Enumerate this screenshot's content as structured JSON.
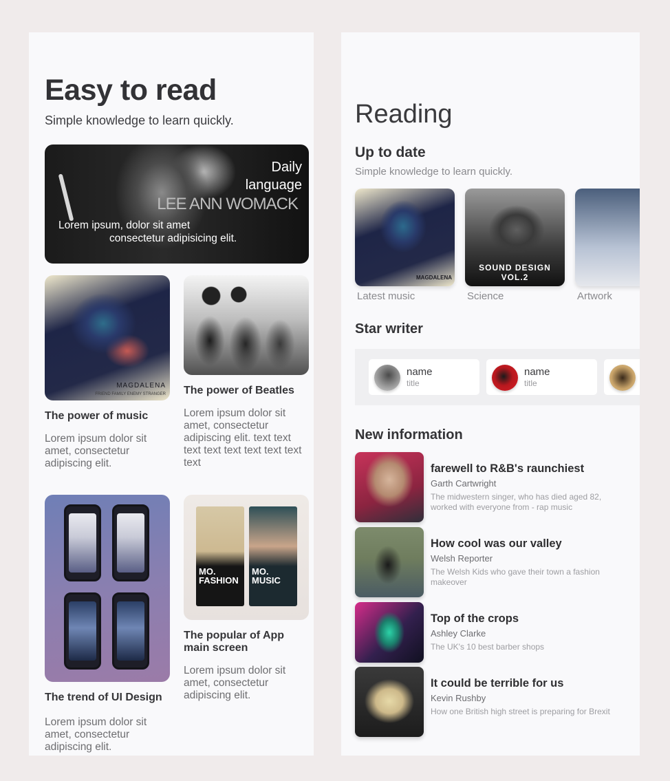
{
  "left": {
    "title": "Easy to read",
    "subtitle": "Simple knowledge to learn quickly.",
    "hero": {
      "title": "Daily language",
      "artist": "LEE ANN WOMACK",
      "text_line1": "Lorem ipsum, dolor sit amet",
      "text_line2": "consectetur adipisicing elit."
    },
    "cards": [
      {
        "title": "The power of music",
        "desc": "Lorem ipsum dolor sit amet, consectetur adipiscing elit.",
        "img_label": "MAGDALENA",
        "img_sub": "FRIEND   FAMILY   ENEMY   STRANGER"
      },
      {
        "title": "The power of Beatles",
        "desc": "Lorem ipsum dolor sit amet, consectetur adipiscing elit. text text text text text text text text text"
      },
      {
        "title": "The trend of UI Design",
        "desc": "Lorem ipsum dolor sit amet, consectetur adipiscing elit."
      },
      {
        "title": "The popular of App main screen",
        "desc": "Lorem ipsum dolor sit amet, consectetur adipiscing elit.",
        "poster1": "MO. FASHION",
        "poster2": "MO. MUSIC"
      }
    ]
  },
  "right": {
    "title": "Reading",
    "up_to_date": {
      "heading": "Up to date",
      "subtitle": "Simple knowledge to learn quickly.",
      "albums": [
        {
          "label": "Latest music",
          "cover_text": "MAGDALENA"
        },
        {
          "label": "Science",
          "cover_text": "SOUND DESIGN VOL.2"
        },
        {
          "label": "Artwork",
          "cover_text": ""
        }
      ]
    },
    "star_writer": {
      "heading": "Star writer",
      "writers": [
        {
          "name": "name",
          "title": "title"
        },
        {
          "name": "name",
          "title": "title"
        },
        {
          "name": "",
          "title": ""
        }
      ]
    },
    "new_information": {
      "heading": "New information",
      "items": [
        {
          "title": "farewell to R&B's raunchiest",
          "author": "Garth Cartwright",
          "desc": "The midwestern singer, who has died aged 82, worked with everyone from - rap music"
        },
        {
          "title": "How cool was our valley",
          "author": "Welsh Reporter",
          "desc": "The Welsh Kids who gave their town a fashion makeover"
        },
        {
          "title": "Top of the crops",
          "author": "Ashley Clarke",
          "desc": "The UK's 10 best barber shops"
        },
        {
          "title": "It could be terrible for us",
          "author": "Kevin Rushby",
          "desc": "How one British high street is preparing for Brexit"
        }
      ]
    }
  }
}
